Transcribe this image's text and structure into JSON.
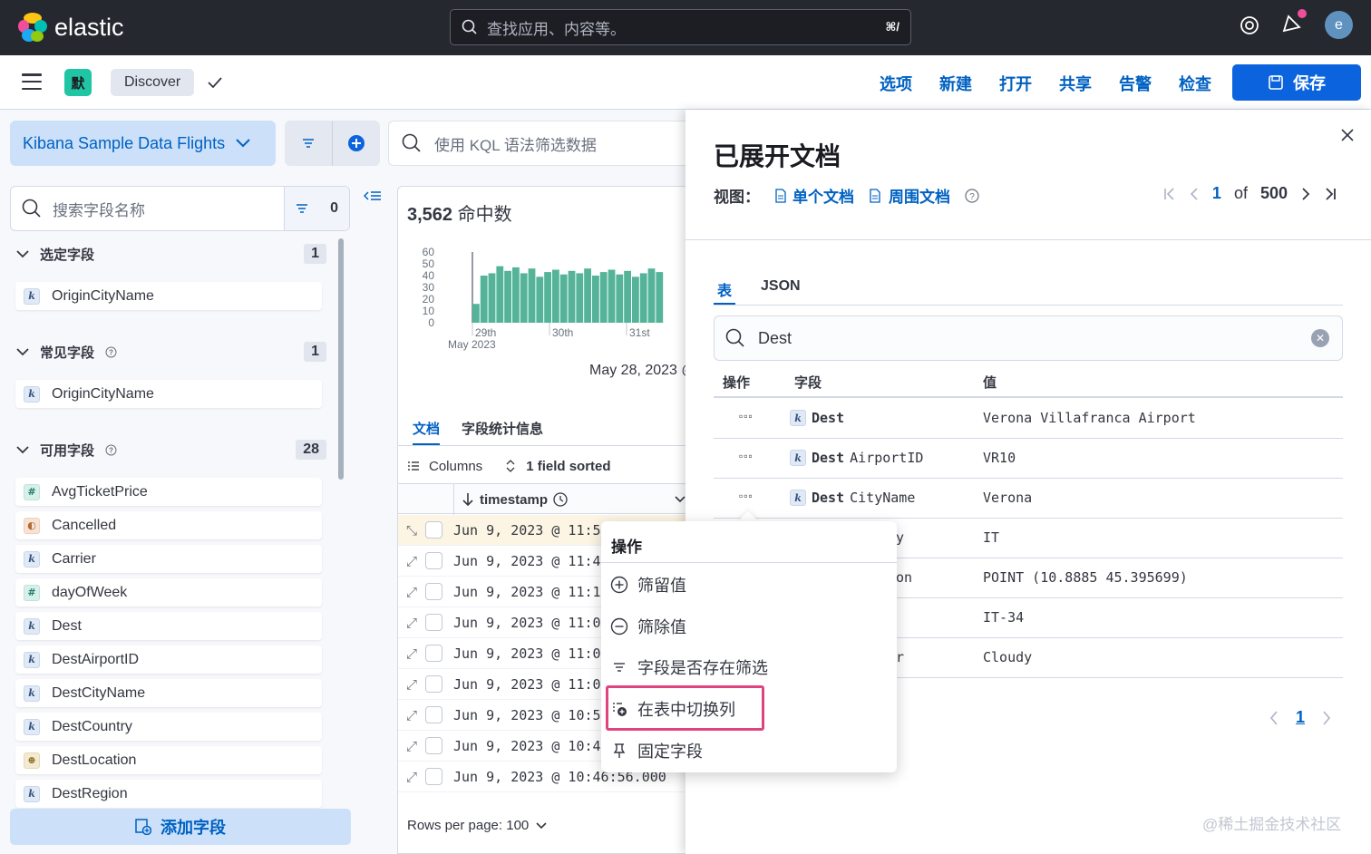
{
  "header": {
    "logo_text": "elastic",
    "search_placeholder": "查找应用、内容等。",
    "search_shortcut": "⌘/",
    "avatar_letter": "e"
  },
  "appbar": {
    "space_badge": "默",
    "breadcrumb": "Discover",
    "menu": [
      "选项",
      "新建",
      "打开",
      "共享",
      "告警",
      "检查"
    ],
    "save_label": "保存"
  },
  "query": {
    "data_view": "Kibana Sample Data Flights",
    "kql_placeholder": "使用 KQL 语法筛选数据"
  },
  "sidebar": {
    "search_placeholder": "搜索字段名称",
    "filter_count": "0",
    "selected": {
      "title": "选定字段",
      "count": "1",
      "fields": [
        {
          "name": "OriginCityName",
          "type": "k"
        }
      ]
    },
    "popular": {
      "title": "常见字段",
      "count": "1",
      "fields": [
        {
          "name": "OriginCityName",
          "type": "k"
        }
      ]
    },
    "available": {
      "title": "可用字段",
      "count": "28",
      "fields": [
        {
          "name": "AvgTicketPrice",
          "type": "#"
        },
        {
          "name": "Cancelled",
          "type": "b"
        },
        {
          "name": "Carrier",
          "type": "k"
        },
        {
          "name": "dayOfWeek",
          "type": "#"
        },
        {
          "name": "Dest",
          "type": "k"
        },
        {
          "name": "DestAirportID",
          "type": "k"
        },
        {
          "name": "DestCityName",
          "type": "k"
        },
        {
          "name": "DestCountry",
          "type": "k"
        },
        {
          "name": "DestLocation",
          "type": "g"
        },
        {
          "name": "DestRegion",
          "type": "k"
        }
      ]
    },
    "add_field": "添加字段"
  },
  "results": {
    "hits_count": "3,562",
    "hits_label": "命中数",
    "date_range": "May 28, 2023 @",
    "tabs": [
      "文档",
      "字段统计信息"
    ],
    "columns_label": "Columns",
    "sorted_label": "1 field sorted",
    "column_timestamp": "timestamp",
    "rows": [
      "Jun 9, 2023 @ 11:5",
      "Jun 9, 2023 @ 11:4",
      "Jun 9, 2023 @ 11:1",
      "Jun 9, 2023 @ 11:0",
      "Jun 9, 2023 @ 11:0",
      "Jun 9, 2023 @ 11:0",
      "Jun 9, 2023 @ 10:5",
      "Jun 9, 2023 @ 10:4",
      "Jun 9, 2023 @ 10:46:56.000"
    ],
    "rows_per_page": "Rows per page: 100"
  },
  "chart_data": {
    "type": "bar",
    "y_ticks": [
      "60",
      "50",
      "40",
      "30",
      "20",
      "10",
      "0"
    ],
    "x_ticks": [
      "29th",
      "30th",
      "31st"
    ],
    "x_sublabel": "May 2023",
    "ylim": [
      0,
      60
    ],
    "values": [
      16,
      40,
      42,
      48,
      44,
      47,
      42,
      46,
      39,
      43,
      45,
      41,
      44,
      42,
      46,
      40,
      43,
      45,
      41,
      44,
      39,
      42,
      46,
      43
    ]
  },
  "flyout": {
    "title": "已展开文档",
    "view_label": "视图：",
    "single_doc": "单个文档",
    "surrounding_doc": "周围文档",
    "page_current": "1",
    "page_of": "of",
    "page_total": "500",
    "tabs": [
      "表",
      "JSON"
    ],
    "search_value": "Dest",
    "col_actions": "操作",
    "col_field": "字段",
    "col_value": "值",
    "rows": [
      {
        "field_bold": "Dest",
        "field_rest": "",
        "value": "Verona Villafranca Airport"
      },
      {
        "field_bold": "Dest",
        "field_rest": "AirportID",
        "value": "VR10"
      },
      {
        "field_bold": "Dest",
        "field_rest": "CityName",
        "value": "Verona"
      },
      {
        "partial": "y",
        "value": "IT"
      },
      {
        "partial": "on",
        "value": "POINT (10.8885 45.395699)"
      },
      {
        "partial": "",
        "value": "IT-34"
      },
      {
        "partial": "r",
        "value": "Cloudy"
      }
    ],
    "bottom_page": "1"
  },
  "popover": {
    "title": "操作",
    "items": [
      "筛留值",
      "筛除值",
      "字段是否存在筛选",
      "在表中切换列",
      "固定字段"
    ]
  },
  "watermark": "@稀土掘金技术社区"
}
